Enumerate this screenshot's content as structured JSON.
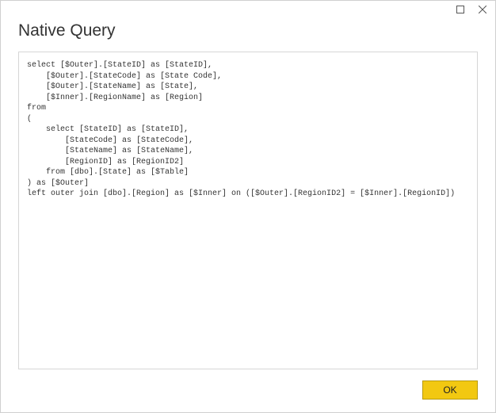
{
  "titlebar": {
    "maximize_icon": "maximize",
    "close_icon": "close"
  },
  "header": {
    "title": "Native Query"
  },
  "query": {
    "text": "select [$Outer].[StateID] as [StateID],\n    [$Outer].[StateCode] as [State Code],\n    [$Outer].[StateName] as [State],\n    [$Inner].[RegionName] as [Region]\nfrom \n(\n    select [StateID] as [StateID],\n        [StateCode] as [StateCode],\n        [StateName] as [StateName],\n        [RegionID] as [RegionID2]\n    from [dbo].[State] as [$Table]\n) as [$Outer]\nleft outer join [dbo].[Region] as [$Inner] on ([$Outer].[RegionID2] = [$Inner].[RegionID])"
  },
  "footer": {
    "ok_label": "OK"
  }
}
